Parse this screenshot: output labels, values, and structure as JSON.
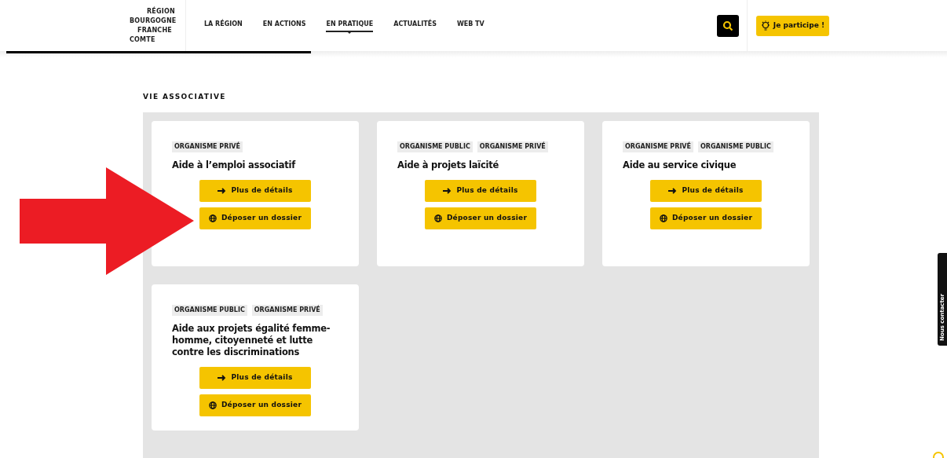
{
  "logo": {
    "lines": [
      "RÉGION",
      "BOURGOGNE",
      "FRANCHE",
      "COMTE"
    ]
  },
  "nav": [
    {
      "label": "LA RÉGION",
      "selected": false
    },
    {
      "label": "EN ACTIONS",
      "selected": false
    },
    {
      "label": "EN PRATIQUE",
      "selected": true
    },
    {
      "label": "ACTUALITÉS",
      "selected": false
    },
    {
      "label": "WEB TV",
      "selected": false
    }
  ],
  "participate_button": "Je participe !",
  "section_title": "VIE ASSOCIATIVE",
  "cards": [
    {
      "tags": [
        "ORGANISME PRIVÉ"
      ],
      "title": "Aide à l’emploi associatif",
      "buttons": [
        {
          "kind": "details",
          "label": "Plus de détails"
        },
        {
          "kind": "submit",
          "label": "Déposer un dossier"
        }
      ]
    },
    {
      "tags": [
        "ORGANISME PUBLIC",
        "ORGANISME PRIVÉ"
      ],
      "title": "Aide à projets laïcité",
      "buttons": [
        {
          "kind": "details",
          "label": "Plus de détails"
        },
        {
          "kind": "submit",
          "label": "Déposer un dossier"
        }
      ]
    },
    {
      "tags": [
        "ORGANISME PRIVÉ",
        "ORGANISME PUBLIC"
      ],
      "title": "Aide au service civique",
      "buttons": [
        {
          "kind": "details",
          "label": "Plus de détails"
        },
        {
          "kind": "submit",
          "label": "Déposer un dossier"
        }
      ]
    },
    {
      "tags": [
        "ORGANISME PUBLIC",
        "ORGANISME PRIVÉ"
      ],
      "title": "Aide aux projets égalité femme-homme, citoyenneté et lutte contre les discriminations",
      "buttons": [
        {
          "kind": "details",
          "label": "Plus de détails"
        },
        {
          "kind": "submit",
          "label": "Déposer un dossier"
        }
      ]
    }
  ],
  "contact_tab": "Nous contacter"
}
